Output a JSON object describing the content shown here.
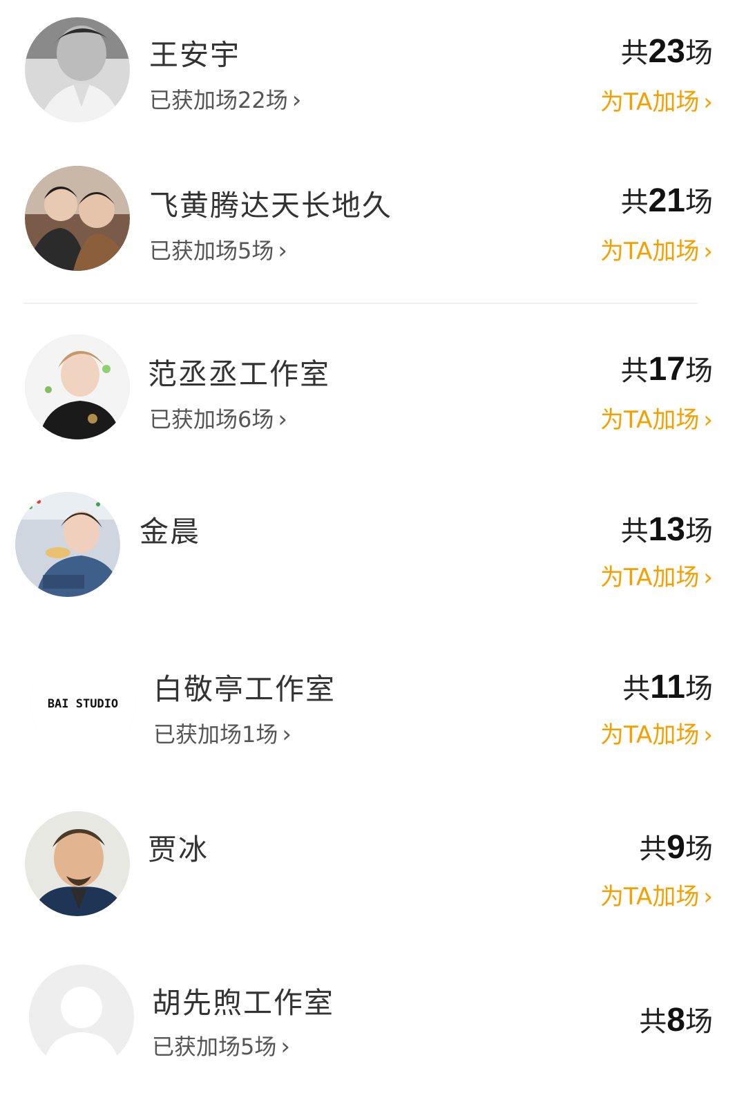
{
  "items": [
    {
      "name": "王安宇",
      "obtained": "已获加场22场",
      "total_prefix": "共",
      "total_num": "23",
      "total_suffix": "场",
      "boost_label": "为TA加场",
      "avatar": "grayscale-portrait"
    },
    {
      "name": "飞黄腾达天长地久",
      "obtained": "已获加场5场",
      "total_prefix": "共",
      "total_num": "21",
      "total_suffix": "场",
      "boost_label": "为TA加场",
      "avatar": "two-person-photo"
    },
    {
      "name": "范丞丞工作室",
      "obtained": "已获加场6场",
      "total_prefix": "共",
      "total_num": "17",
      "total_suffix": "场",
      "boost_label": "为TA加场",
      "avatar": "portrait-black-suit"
    },
    {
      "name": "金晨",
      "obtained": "",
      "total_prefix": "共",
      "total_num": "13",
      "total_suffix": "场",
      "boost_label": "为TA加场",
      "avatar": "eating-photo"
    },
    {
      "name": "白敬亭工作室",
      "obtained": "已获加场1场",
      "total_prefix": "共",
      "total_num": "11",
      "total_suffix": "场",
      "boost_label": "为TA加场",
      "avatar": "studio-logo",
      "logo_text": "BAI STUDIO"
    },
    {
      "name": "贾冰",
      "obtained": "",
      "total_prefix": "共",
      "total_num": "9",
      "total_suffix": "场",
      "boost_label": "为TA加场",
      "avatar": "portrait-smiling-man"
    },
    {
      "name": "胡先煦工作室",
      "obtained": "已获加场5场",
      "total_prefix": "共",
      "total_num": "8",
      "total_suffix": "场",
      "boost_label": "",
      "avatar": "default-person"
    }
  ],
  "colors": {
    "accent": "#f5a000",
    "primary_text": "#333333",
    "secondary_text": "#555555",
    "divider": "#efefef"
  },
  "icons": {
    "chevron": "chevron-right-icon"
  }
}
